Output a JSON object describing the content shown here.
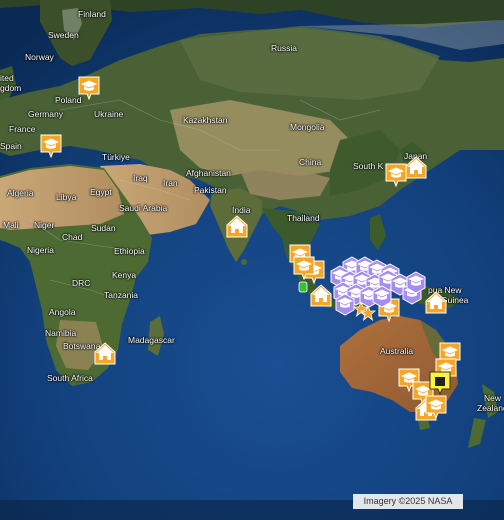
{
  "map": {
    "attribution": "Imagery ©2025 NASA",
    "colors": {
      "ocean": "#123f7a",
      "ocean_deep": "#0b2b57",
      "land_green": "#3d5e2a",
      "land_desert": "#b89a6c",
      "land_snow": "#e8ece8",
      "orange_marker": "#f6a623",
      "purple_marker": "#a48cf0",
      "green_marker": "#3cbc3c",
      "yellow_marker": "#fff23a"
    },
    "labels": [
      {
        "text": "Finland"
      },
      {
        "text": "Sweden"
      },
      {
        "text": "Norway"
      },
      {
        "text": "ited"
      },
      {
        "text": "gdom"
      },
      {
        "text": "Poland"
      },
      {
        "text": "Germany"
      },
      {
        "text": "Ukraine"
      },
      {
        "text": "France"
      },
      {
        "text": "Spain"
      },
      {
        "text": "Türkiye"
      },
      {
        "text": "Russia"
      },
      {
        "text": "Kazakhstan"
      },
      {
        "text": "Mongolia"
      },
      {
        "text": "China"
      },
      {
        "text": "South K"
      },
      {
        "text": "Japan"
      },
      {
        "text": "Iraq"
      },
      {
        "text": "Iran"
      },
      {
        "text": "Afghanistan"
      },
      {
        "text": "Pakistan"
      },
      {
        "text": "India"
      },
      {
        "text": "Thailand"
      },
      {
        "text": "Algeria"
      },
      {
        "text": "Libya"
      },
      {
        "text": "Egypt"
      },
      {
        "text": "Saudi Arabia"
      },
      {
        "text": "Mali"
      },
      {
        "text": "Niger"
      },
      {
        "text": "Chad"
      },
      {
        "text": "Sudan"
      },
      {
        "text": "Nigeria"
      },
      {
        "text": "Ethiopia"
      },
      {
        "text": "Kenya"
      },
      {
        "text": "DRC"
      },
      {
        "text": "Tanzania"
      },
      {
        "text": "Angola"
      },
      {
        "text": "Namibia"
      },
      {
        "text": "Botswana"
      },
      {
        "text": "Madagascar"
      },
      {
        "text": "South Africa"
      },
      {
        "text": "Australia"
      },
      {
        "text": "pua New"
      },
      {
        "text": "Guinea"
      },
      {
        "text": "New"
      },
      {
        "text": "Zealand"
      }
    ],
    "markers": [
      {
        "type": "school",
        "color": "orange"
      },
      {
        "type": "school",
        "color": "orange"
      },
      {
        "type": "school",
        "color": "orange"
      },
      {
        "type": "home",
        "color": "orange"
      },
      {
        "type": "home",
        "color": "orange"
      },
      {
        "type": "school",
        "color": "orange"
      },
      {
        "type": "school",
        "color": "orange"
      },
      {
        "type": "school",
        "color": "orange"
      },
      {
        "type": "home",
        "color": "orange"
      },
      {
        "type": "school",
        "color": "orange"
      },
      {
        "type": "home",
        "color": "orange"
      },
      {
        "type": "home",
        "color": "orange"
      },
      {
        "type": "school",
        "color": "orange"
      },
      {
        "type": "school",
        "color": "orange"
      },
      {
        "type": "school",
        "color": "orange"
      },
      {
        "type": "school",
        "color": "orange"
      },
      {
        "type": "home",
        "color": "orange"
      },
      {
        "type": "school",
        "color": "orange"
      },
      {
        "type": "star",
        "color": "orange"
      },
      {
        "type": "star",
        "color": "orange"
      },
      {
        "type": "school",
        "color": "purple"
      },
      {
        "type": "school",
        "color": "purple"
      },
      {
        "type": "school",
        "color": "purple"
      },
      {
        "type": "school",
        "color": "purple"
      },
      {
        "type": "school",
        "color": "purple"
      },
      {
        "type": "school",
        "color": "purple"
      },
      {
        "type": "school",
        "color": "purple"
      },
      {
        "type": "school",
        "color": "purple"
      },
      {
        "type": "school",
        "color": "purple"
      },
      {
        "type": "school",
        "color": "purple"
      },
      {
        "type": "school",
        "color": "purple"
      },
      {
        "type": "school",
        "color": "purple"
      },
      {
        "type": "school",
        "color": "purple"
      },
      {
        "type": "school",
        "color": "purple"
      },
      {
        "type": "school",
        "color": "purple"
      },
      {
        "type": "school",
        "color": "purple"
      },
      {
        "type": "school",
        "color": "purple"
      },
      {
        "type": "pin",
        "color": "green"
      },
      {
        "type": "building",
        "color": "yellow"
      }
    ]
  }
}
